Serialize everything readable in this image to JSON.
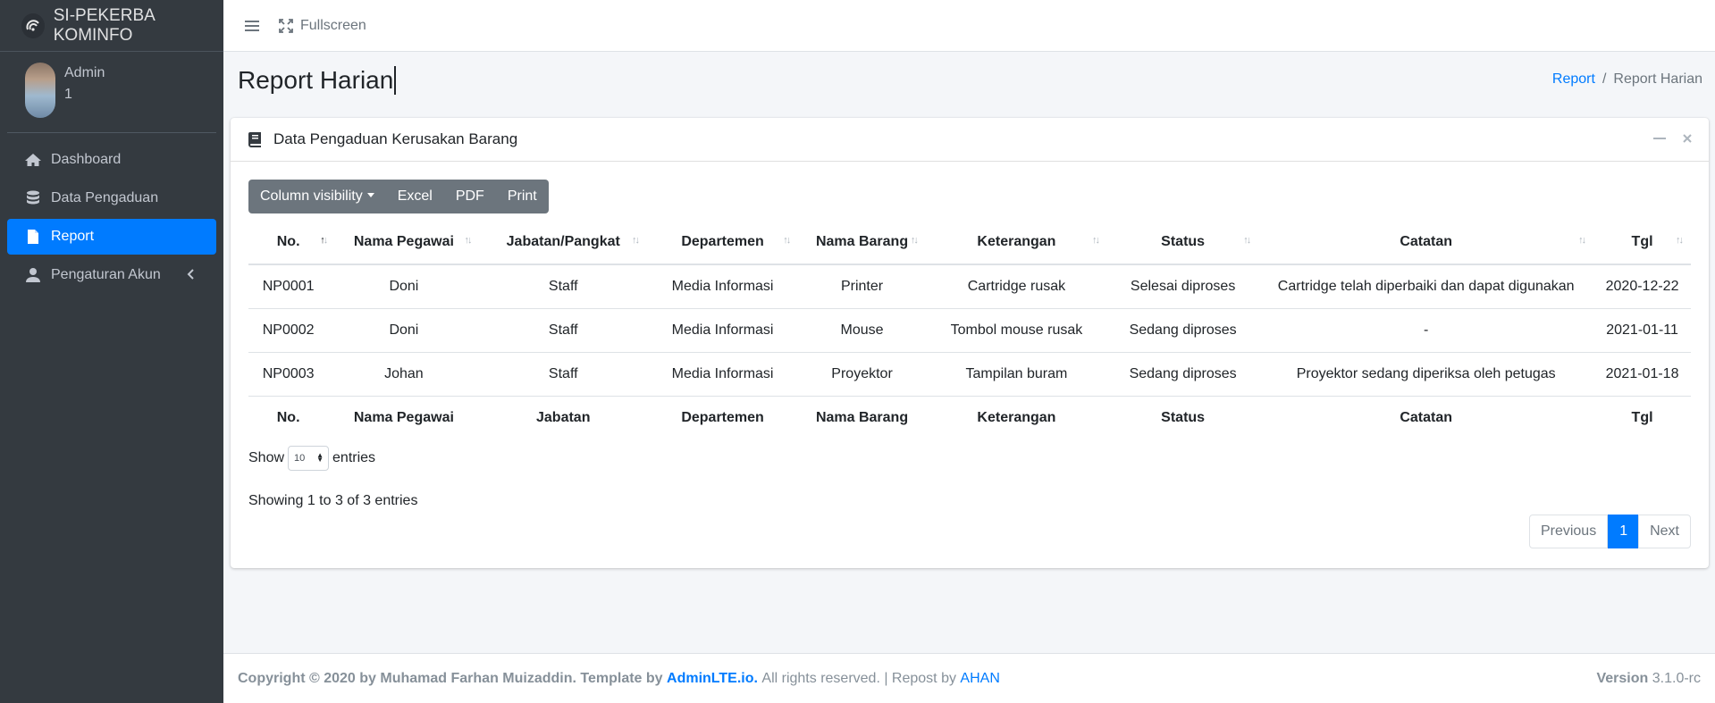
{
  "brand": {
    "title": "SI-PEKERBA KOMINFO"
  },
  "user": {
    "name": "Admin",
    "id": "1"
  },
  "sidebar": {
    "items": [
      {
        "label": "Dashboard",
        "icon": "home-icon"
      },
      {
        "label": "Data Pengaduan",
        "icon": "database-icon"
      },
      {
        "label": "Report",
        "icon": "file-icon",
        "active": true
      },
      {
        "label": "Pengaturan Akun",
        "icon": "user-icon"
      }
    ]
  },
  "topbar": {
    "fullscreen_label": "Fullscreen"
  },
  "page": {
    "title": "Report Harian"
  },
  "breadcrumb": {
    "link": "Report",
    "sep": "/",
    "current": "Report Harian"
  },
  "card": {
    "title": "Data Pengaduan Kerusakan Barang"
  },
  "buttons": {
    "colvis": "Column visibility",
    "excel": "Excel",
    "pdf": "PDF",
    "print": "Print"
  },
  "table": {
    "headers": [
      "No.",
      "Nama Pegawai",
      "Jabatan/Pangkat",
      "Departemen",
      "Nama Barang",
      "Keterangan",
      "Status",
      "Catatan",
      "Tgl"
    ],
    "footers": [
      "No.",
      "Nama Pegawai",
      "Jabatan",
      "Departemen",
      "Nama Barang",
      "Keterangan",
      "Status",
      "Catatan",
      "Tgl"
    ],
    "rows": [
      [
        "NP0001",
        "Doni",
        "Staff",
        "Media Informasi",
        "Printer",
        "Cartridge rusak",
        "Selesai diproses",
        "Cartridge telah diperbaiki dan dapat digunakan",
        "2020-12-22"
      ],
      [
        "NP0002",
        "Doni",
        "Staff",
        "Media Informasi",
        "Mouse",
        "Tombol mouse rusak",
        "Sedang diproses",
        "-",
        "2021-01-11"
      ],
      [
        "NP0003",
        "Johan",
        "Staff",
        "Media Informasi",
        "Proyektor",
        "Tampilan buram",
        "Sedang diproses",
        "Proyektor sedang diperiksa oleh petugas",
        "2021-01-18"
      ]
    ]
  },
  "length": {
    "show": "Show",
    "value": "10",
    "entries": "entries"
  },
  "info": "Showing 1 to 3 of 3 entries",
  "pager": {
    "prev": "Previous",
    "page": "1",
    "next": "Next"
  },
  "footer": {
    "copyright": "Copyright © 2020 by Muhamad Farhan Muizaddin. Template by",
    "template_link": "AdminLTE.io.",
    "rights": "All rights reserved. | Repost by",
    "repost_link": "AHAN",
    "version_label": "Version",
    "version": "3.1.0-rc"
  }
}
